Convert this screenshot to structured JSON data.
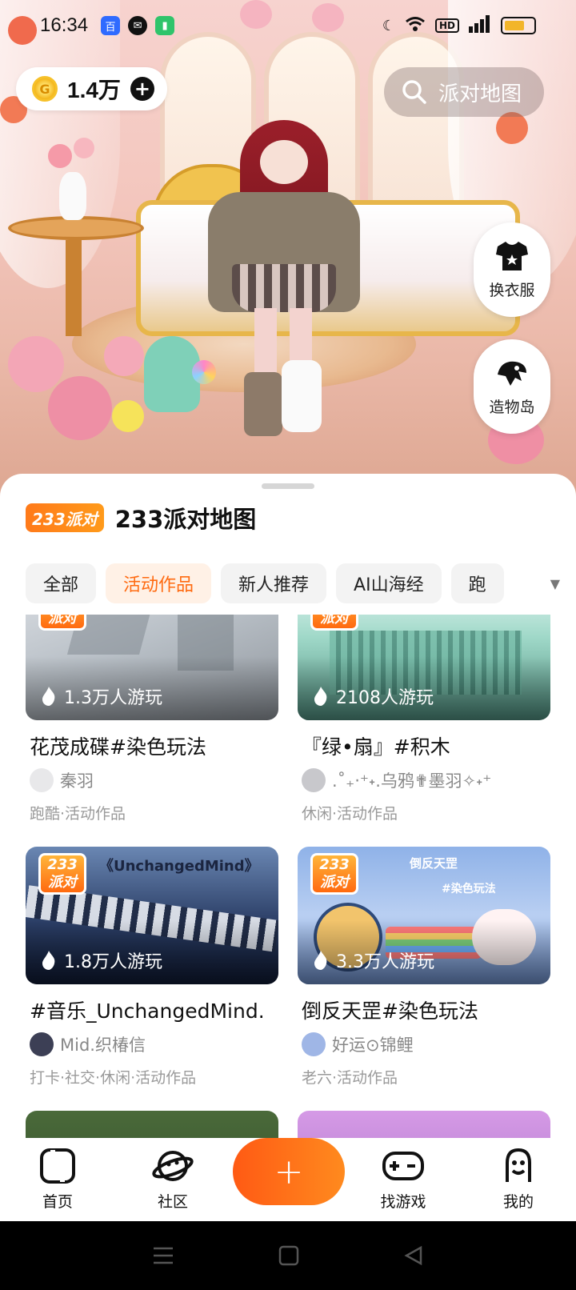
{
  "status_bar": {
    "time": "16:34",
    "notification_icons": [
      "baidu-app-icon",
      "wechat-icon",
      "battery-saver-icon"
    ],
    "system_icons": [
      "moon-icon",
      "wifi-icon",
      "hd-icon",
      "signal-icon",
      "battery-icon"
    ],
    "hd_label": "HD"
  },
  "header": {
    "coin_amount": "1.4万",
    "search_placeholder": "派对地图"
  },
  "side_buttons": [
    {
      "label": "换衣服",
      "icon": "tshirt-icon"
    },
    {
      "label": "造物岛",
      "icon": "island-icon"
    }
  ],
  "sheet": {
    "brand": "233派对",
    "title": "233派对地图",
    "tabs": [
      {
        "label": "全部",
        "active": false
      },
      {
        "label": "活动作品",
        "active": true
      },
      {
        "label": "新人推荐",
        "active": false
      },
      {
        "label": "AI山海经",
        "active": false
      },
      {
        "label": "跑",
        "active": false
      }
    ],
    "badge_text_top": "233",
    "badge_text_bottom": "派对",
    "cards": [
      {
        "plays": "1.3万人游玩",
        "title": "花茂成碟#染色玩法",
        "author": "秦羽",
        "tags": "跑酷·活动作品"
      },
      {
        "plays": "2108人游玩",
        "title": "『绿•扇』#积木",
        "author": ".˚₊‧⁺˖.乌鸦✟墨羽✧˖⁺",
        "tags": "休闲·活动作品"
      },
      {
        "plays": "1.8万人游玩",
        "title": "#音乐_UnchangedMind.",
        "author": "Mid.织椿信",
        "tags": "打卡·社交·休闲·活动作品"
      },
      {
        "plays": "3.3万人游玩",
        "title": "倒反天罡#染色玩法",
        "author": "好运⊙锦鲤",
        "tags": "老六·活动作品"
      }
    ],
    "thumb_texts": {
      "card3": "《UnchangedMind》",
      "card4_title": "倒反天罡",
      "card4_sub": "#染色玩法"
    }
  },
  "bottom_nav": [
    {
      "label": "首页",
      "icon": "home-icon"
    },
    {
      "label": "社区",
      "icon": "planet-icon"
    },
    {
      "label": "+",
      "icon": "plus-icon"
    },
    {
      "label": "找游戏",
      "icon": "gamepad-icon"
    },
    {
      "label": "我的",
      "icon": "profile-icon"
    }
  ],
  "colors": {
    "accent": "#ff6a10",
    "tab_active_bg": "#fff1e6"
  }
}
